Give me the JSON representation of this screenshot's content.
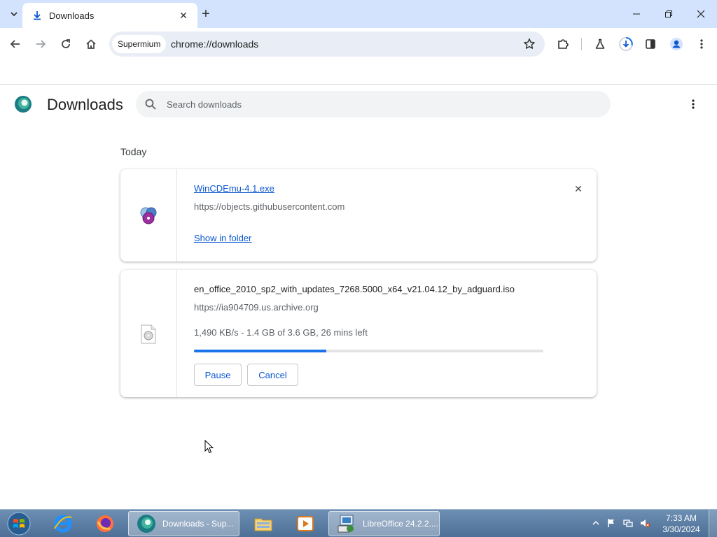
{
  "tab": {
    "title": "Downloads"
  },
  "toolbar": {
    "chip_label": "Supermium",
    "url": "chrome://downloads"
  },
  "page": {
    "title": "Downloads",
    "search_placeholder": "Search downloads",
    "section_label": "Today"
  },
  "downloads": [
    {
      "file_name": "WinCDEmu-4.1.exe",
      "source": "https://objects.githubusercontent.com",
      "action_link": "Show in folder"
    },
    {
      "file_name": "en_office_2010_sp2_with_updates_7268.5000_x64_v21.04.12_by_adguard.iso",
      "source": "https://ia904709.us.archive.org",
      "status": "1,490 KB/s - 1.4 GB of 3.6 GB, 26 mins left",
      "progress_fraction": 0.378,
      "pause_label": "Pause",
      "cancel_label": "Cancel"
    }
  ],
  "taskbar": {
    "items": [
      {
        "label": "Downloads - Sup...",
        "icon": "supermium-icon"
      },
      {
        "label": "LibreOffice 24.2.2....",
        "icon": "libreoffice-icon"
      }
    ],
    "clock_time": "7:33 AM",
    "clock_date": "3/30/2024"
  },
  "colors": {
    "accent": "#0b57d0",
    "tabstrip": "#d3e3fd",
    "progress": "#1a73e8"
  }
}
